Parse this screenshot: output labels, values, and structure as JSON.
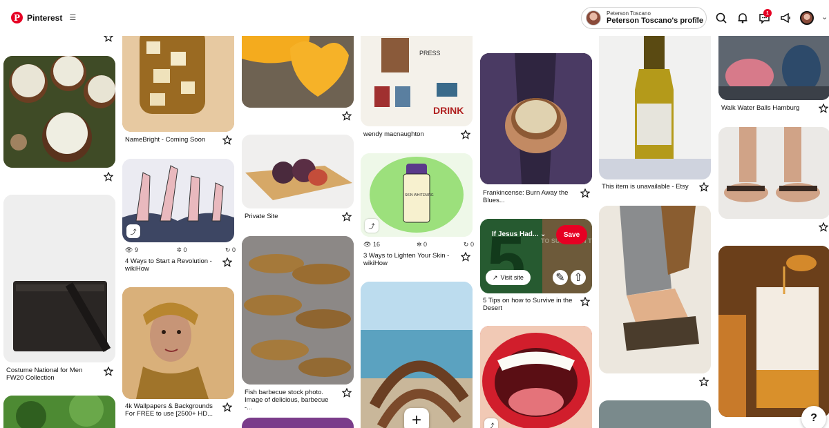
{
  "header": {
    "brand": "Pinterest",
    "menu_icon": "hamburger-icon",
    "profile_small": "Peterson Toscano",
    "profile_name": "Peterson Toscano's profile",
    "notification_badge": "1"
  },
  "pins": {
    "namebright": "NameBright - Coming Soon",
    "private_site": "Private Site",
    "wendy": "wendy macnaughton",
    "frankincense": "Frankincense: Burn Away the Blues...",
    "etsy": "This item is unavailable - Etsy",
    "walk_water": "Walk Water Balls Hamburg",
    "revolution": "4 Ways to Start a Revolution - wikiHow",
    "lighten_skin": "3 Ways to Lighten Your Skin - wikiHow",
    "costume": "Costume National for Men FW20 Collection",
    "wallpapers": "4k Wallpapers & Backgrounds For FREE to use [2500+ HD...",
    "fish": "Fish barbecue stock photo. Image of delicious, barbecue -...",
    "desert": "5 Tips on how to Survive in the Desert",
    "jar_label": "SKIN WHITENING"
  },
  "stats": {
    "revolution": {
      "views": "9",
      "saves": "0",
      "repins": "0"
    },
    "lighten": {
      "views": "16",
      "saves": "0",
      "repins": "0"
    }
  },
  "hover": {
    "board": "If Jesus Had...",
    "save": "Save",
    "visit": "Visit site",
    "overlay_text": "TO SURVIVE IN THE DESERT",
    "big_number": "5"
  },
  "poster": {
    "drink": "DRINK",
    "press": "PRESS"
  },
  "colors": {
    "brand_red": "#e60023"
  }
}
